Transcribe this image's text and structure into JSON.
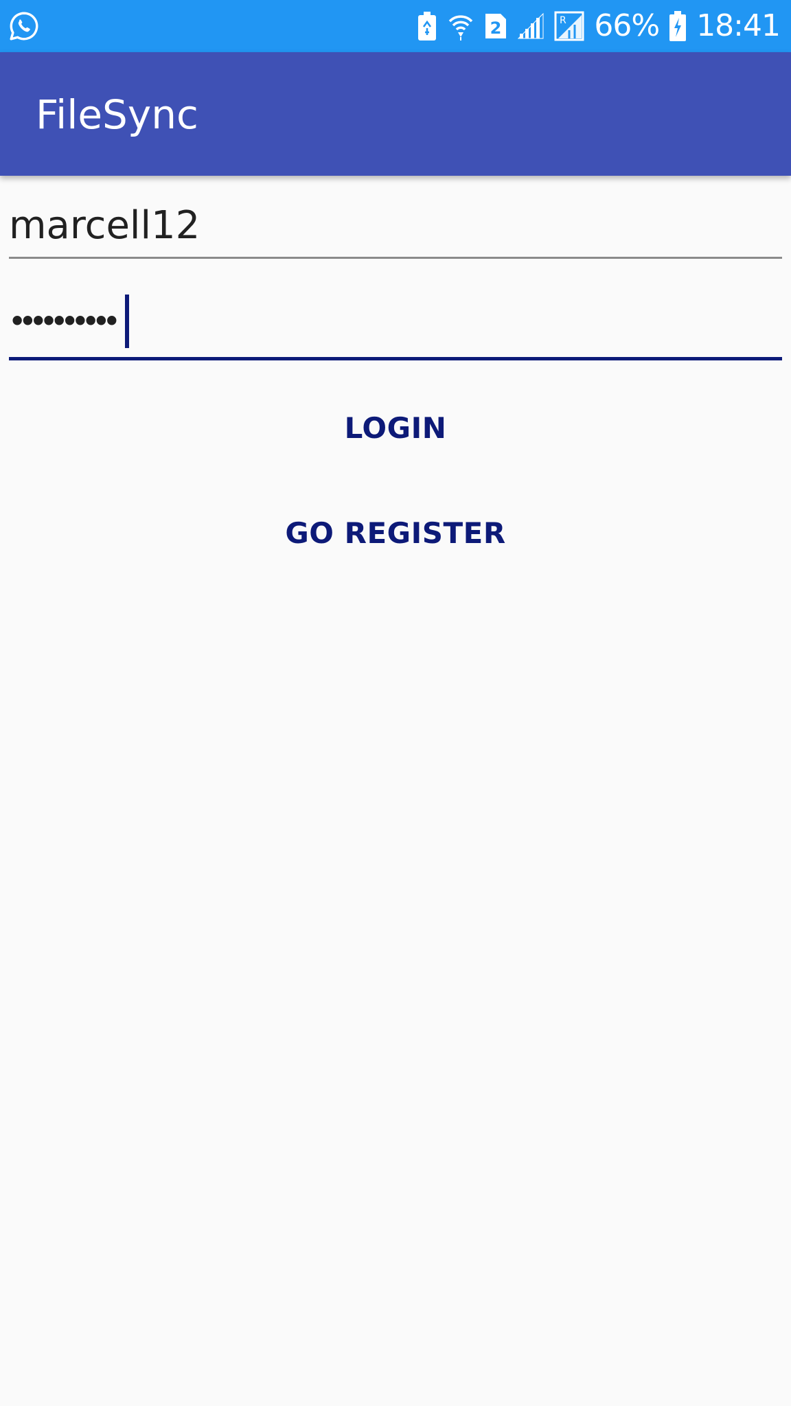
{
  "status_bar": {
    "left_icon": "whatsapp-icon",
    "icons": [
      "battery-saver-icon",
      "wifi-icon",
      "sim-2-icon",
      "signal-icon",
      "roaming-signal-icon"
    ],
    "battery_percent": "66%",
    "battery_icon": "battery-charging-icon",
    "time": "18:41",
    "background_color": "#2196f3"
  },
  "app_bar": {
    "title": "FileSync",
    "background_color": "#3f51b5"
  },
  "login_form": {
    "username_value": "marcell12",
    "password_mask": "••••••••••",
    "login_label": "LOGIN",
    "register_label": "GO REGISTER",
    "accent_color": "#0d1a78"
  }
}
